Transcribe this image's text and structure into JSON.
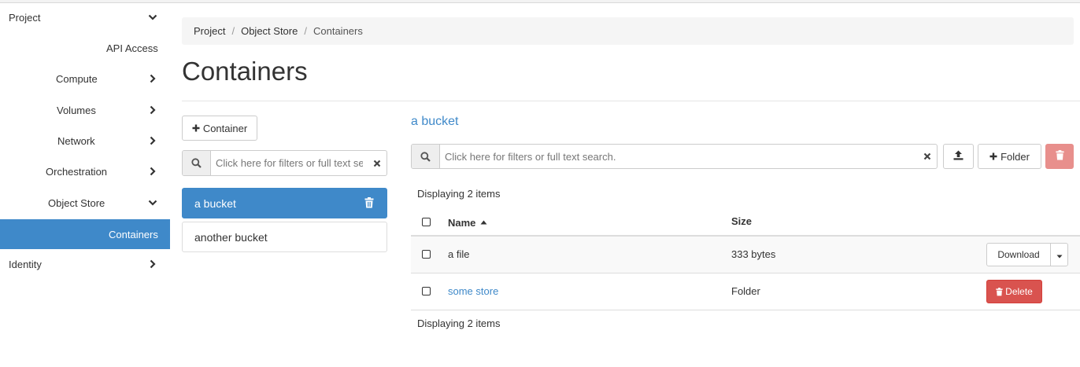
{
  "sidebar": {
    "items": [
      {
        "label": "Project",
        "chevron": "down"
      },
      {
        "label": "API Access",
        "chevron": ""
      },
      {
        "label": "Compute",
        "chevron": "right"
      },
      {
        "label": "Volumes",
        "chevron": "right"
      },
      {
        "label": "Network",
        "chevron": "right"
      },
      {
        "label": "Orchestration",
        "chevron": "right"
      },
      {
        "label": "Object Store",
        "chevron": "down"
      },
      {
        "label": "Containers",
        "chevron": "",
        "active": true
      },
      {
        "label": "Identity",
        "chevron": "right"
      }
    ]
  },
  "breadcrumb": {
    "items": [
      "Project",
      "Object Store"
    ],
    "current": "Containers",
    "separator": "/"
  },
  "page": {
    "title": "Containers"
  },
  "containers_panel": {
    "add_button_label": "Container",
    "search_placeholder": "Click here for filters or full text search.",
    "items": [
      {
        "name": "a bucket",
        "active": true
      },
      {
        "name": "another bucket",
        "active": false
      }
    ]
  },
  "objects_panel": {
    "bucket_name": "a bucket",
    "search_placeholder": "Click here for filters or full text search.",
    "folder_button_label": "Folder",
    "displaying_top": "Displaying 2 items",
    "displaying_bottom": "Displaying 2 items",
    "columns": {
      "name": "Name",
      "size": "Size"
    },
    "rows": [
      {
        "name": "a file",
        "size": "333 bytes",
        "action": "Download",
        "is_link": false
      },
      {
        "name": "some store",
        "size": "Folder",
        "action": "Delete",
        "is_link": true
      }
    ]
  },
  "icons": {
    "search": "search-icon",
    "clear": "times-icon",
    "plus": "plus-icon",
    "upload": "upload-icon",
    "trash": "trash-icon",
    "chevron_right": "chevron-right-icon",
    "chevron_down": "chevron-down-icon",
    "caret_down": "caret-down-icon",
    "sort_up": "sort-asc-icon"
  },
  "colors": {
    "primary": "#3f89c9",
    "danger": "#d9534f",
    "danger_disabled": "#e88f8c",
    "breadcrumb_bg": "#f5f5f5"
  }
}
